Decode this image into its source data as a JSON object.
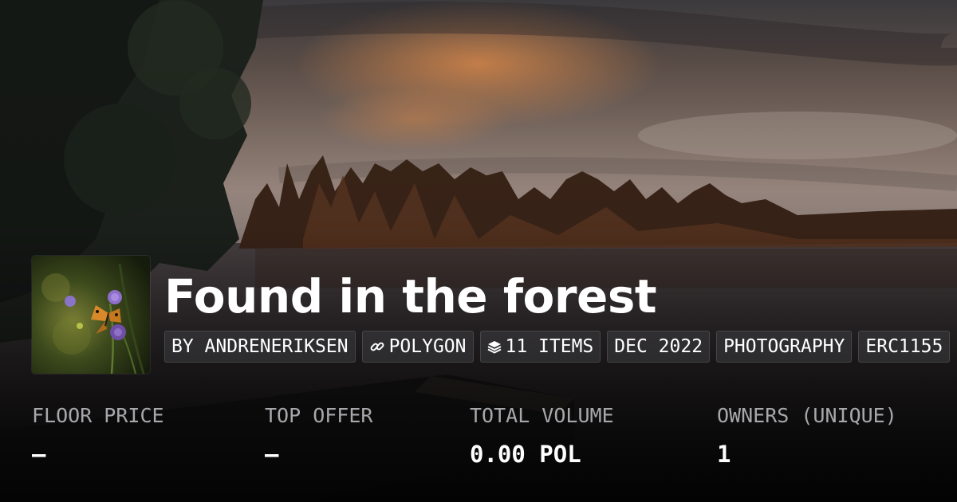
{
  "collection": {
    "title": "Found in the forest"
  },
  "chips": [
    {
      "icon": "",
      "label": "BY ANDRENERIKSEN"
    },
    {
      "icon": "link-icon",
      "label": "POLYGON"
    },
    {
      "icon": "layers-icon",
      "label": "11 ITEMS"
    },
    {
      "icon": "",
      "label": "DEC 2022"
    },
    {
      "icon": "",
      "label": "PHOTOGRAPHY"
    },
    {
      "icon": "",
      "label": "ERC1155"
    }
  ],
  "stats": [
    {
      "label": "FLOOR PRICE",
      "value": "—"
    },
    {
      "label": "TOP OFFER",
      "value": "—"
    },
    {
      "label": "TOTAL VOLUME",
      "value": "0.00 POL"
    },
    {
      "label": "OWNERS (UNIQUE)",
      "value": "1"
    }
  ],
  "colors": {
    "background": "#0b0b0d",
    "chip_background": "#3c3c40",
    "label_gray": "#a8a8ac"
  }
}
